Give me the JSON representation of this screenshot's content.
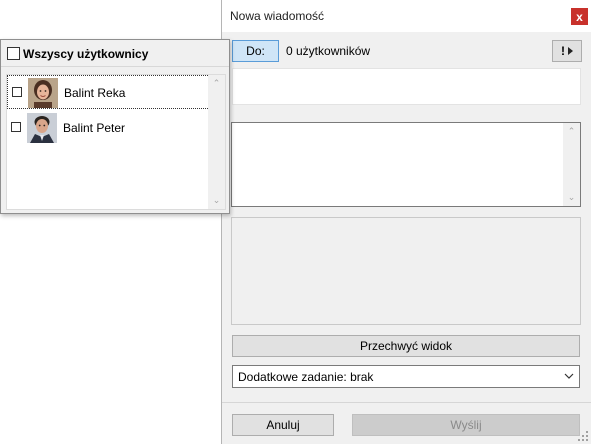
{
  "dialog": {
    "title": "Nowa wiadomość",
    "close_glyph": "x",
    "to_button": "Do:",
    "recipients_count": "0 użytkowników",
    "priority": {
      "symbol": "!"
    },
    "capture_button": "Przechwyć widok",
    "extra_task": "Dodatkowe zadanie: brak",
    "cancel_button": "Anuluj",
    "send_button": "Wyślij"
  },
  "user_picker": {
    "select_all_label": "Wszyscy użytkownicy",
    "users": [
      {
        "name": "Balint Reka",
        "checked": false,
        "selected": true,
        "avatar": "woman-portrait"
      },
      {
        "name": "Balint Peter",
        "checked": false,
        "selected": false,
        "avatar": "man-portrait"
      }
    ]
  },
  "icons": {
    "close": "close-icon",
    "priority_arrow": "triangle-right-icon",
    "dropdown": "chevron-down-icon",
    "scroll_up": "scroll-up-icon",
    "scroll_down": "scroll-down-icon"
  },
  "colors": {
    "close_button": "#c8312b",
    "to_button_bg": "#cfe5f7",
    "to_button_border": "#5a9cd8",
    "dialog_bg": "#f0f0f0",
    "disabled_text": "#8a8a8a"
  }
}
